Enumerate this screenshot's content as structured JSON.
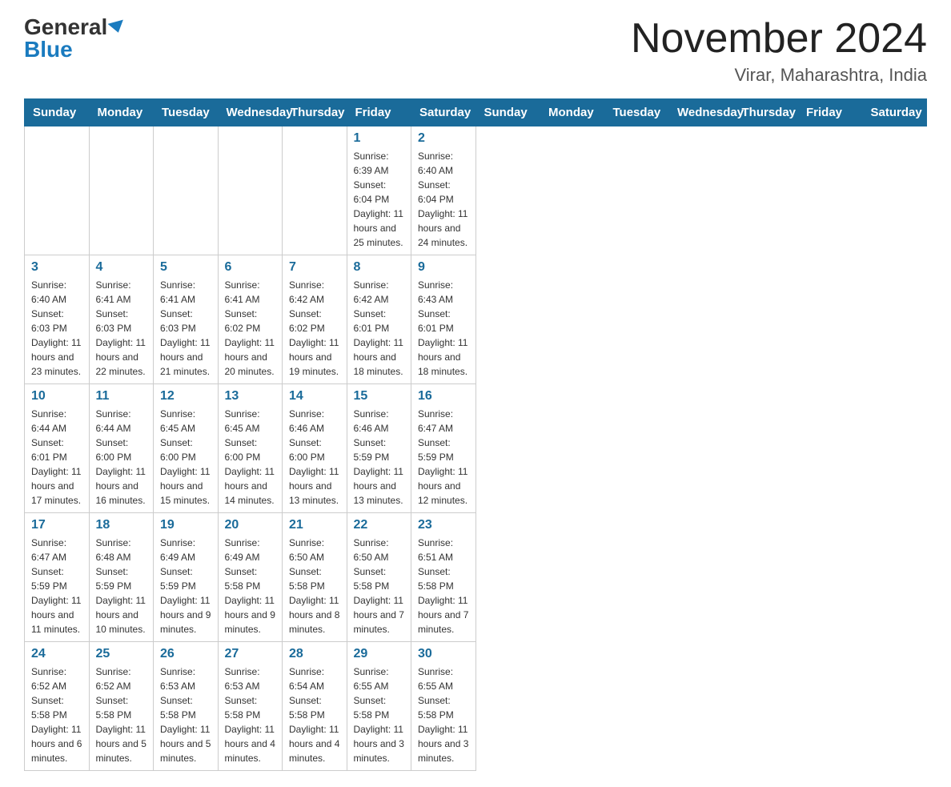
{
  "header": {
    "logo_general": "General",
    "logo_blue": "Blue",
    "month_title": "November 2024",
    "location": "Virar, Maharashtra, India"
  },
  "days_of_week": [
    "Sunday",
    "Monday",
    "Tuesday",
    "Wednesday",
    "Thursday",
    "Friday",
    "Saturday"
  ],
  "weeks": [
    [
      {
        "day": "",
        "info": ""
      },
      {
        "day": "",
        "info": ""
      },
      {
        "day": "",
        "info": ""
      },
      {
        "day": "",
        "info": ""
      },
      {
        "day": "",
        "info": ""
      },
      {
        "day": "1",
        "info": "Sunrise: 6:39 AM\nSunset: 6:04 PM\nDaylight: 11 hours and 25 minutes."
      },
      {
        "day": "2",
        "info": "Sunrise: 6:40 AM\nSunset: 6:04 PM\nDaylight: 11 hours and 24 minutes."
      }
    ],
    [
      {
        "day": "3",
        "info": "Sunrise: 6:40 AM\nSunset: 6:03 PM\nDaylight: 11 hours and 23 minutes."
      },
      {
        "day": "4",
        "info": "Sunrise: 6:41 AM\nSunset: 6:03 PM\nDaylight: 11 hours and 22 minutes."
      },
      {
        "day": "5",
        "info": "Sunrise: 6:41 AM\nSunset: 6:03 PM\nDaylight: 11 hours and 21 minutes."
      },
      {
        "day": "6",
        "info": "Sunrise: 6:41 AM\nSunset: 6:02 PM\nDaylight: 11 hours and 20 minutes."
      },
      {
        "day": "7",
        "info": "Sunrise: 6:42 AM\nSunset: 6:02 PM\nDaylight: 11 hours and 19 minutes."
      },
      {
        "day": "8",
        "info": "Sunrise: 6:42 AM\nSunset: 6:01 PM\nDaylight: 11 hours and 18 minutes."
      },
      {
        "day": "9",
        "info": "Sunrise: 6:43 AM\nSunset: 6:01 PM\nDaylight: 11 hours and 18 minutes."
      }
    ],
    [
      {
        "day": "10",
        "info": "Sunrise: 6:44 AM\nSunset: 6:01 PM\nDaylight: 11 hours and 17 minutes."
      },
      {
        "day": "11",
        "info": "Sunrise: 6:44 AM\nSunset: 6:00 PM\nDaylight: 11 hours and 16 minutes."
      },
      {
        "day": "12",
        "info": "Sunrise: 6:45 AM\nSunset: 6:00 PM\nDaylight: 11 hours and 15 minutes."
      },
      {
        "day": "13",
        "info": "Sunrise: 6:45 AM\nSunset: 6:00 PM\nDaylight: 11 hours and 14 minutes."
      },
      {
        "day": "14",
        "info": "Sunrise: 6:46 AM\nSunset: 6:00 PM\nDaylight: 11 hours and 13 minutes."
      },
      {
        "day": "15",
        "info": "Sunrise: 6:46 AM\nSunset: 5:59 PM\nDaylight: 11 hours and 13 minutes."
      },
      {
        "day": "16",
        "info": "Sunrise: 6:47 AM\nSunset: 5:59 PM\nDaylight: 11 hours and 12 minutes."
      }
    ],
    [
      {
        "day": "17",
        "info": "Sunrise: 6:47 AM\nSunset: 5:59 PM\nDaylight: 11 hours and 11 minutes."
      },
      {
        "day": "18",
        "info": "Sunrise: 6:48 AM\nSunset: 5:59 PM\nDaylight: 11 hours and 10 minutes."
      },
      {
        "day": "19",
        "info": "Sunrise: 6:49 AM\nSunset: 5:59 PM\nDaylight: 11 hours and 9 minutes."
      },
      {
        "day": "20",
        "info": "Sunrise: 6:49 AM\nSunset: 5:58 PM\nDaylight: 11 hours and 9 minutes."
      },
      {
        "day": "21",
        "info": "Sunrise: 6:50 AM\nSunset: 5:58 PM\nDaylight: 11 hours and 8 minutes."
      },
      {
        "day": "22",
        "info": "Sunrise: 6:50 AM\nSunset: 5:58 PM\nDaylight: 11 hours and 7 minutes."
      },
      {
        "day": "23",
        "info": "Sunrise: 6:51 AM\nSunset: 5:58 PM\nDaylight: 11 hours and 7 minutes."
      }
    ],
    [
      {
        "day": "24",
        "info": "Sunrise: 6:52 AM\nSunset: 5:58 PM\nDaylight: 11 hours and 6 minutes."
      },
      {
        "day": "25",
        "info": "Sunrise: 6:52 AM\nSunset: 5:58 PM\nDaylight: 11 hours and 5 minutes."
      },
      {
        "day": "26",
        "info": "Sunrise: 6:53 AM\nSunset: 5:58 PM\nDaylight: 11 hours and 5 minutes."
      },
      {
        "day": "27",
        "info": "Sunrise: 6:53 AM\nSunset: 5:58 PM\nDaylight: 11 hours and 4 minutes."
      },
      {
        "day": "28",
        "info": "Sunrise: 6:54 AM\nSunset: 5:58 PM\nDaylight: 11 hours and 4 minutes."
      },
      {
        "day": "29",
        "info": "Sunrise: 6:55 AM\nSunset: 5:58 PM\nDaylight: 11 hours and 3 minutes."
      },
      {
        "day": "30",
        "info": "Sunrise: 6:55 AM\nSunset: 5:58 PM\nDaylight: 11 hours and 3 minutes."
      }
    ]
  ]
}
